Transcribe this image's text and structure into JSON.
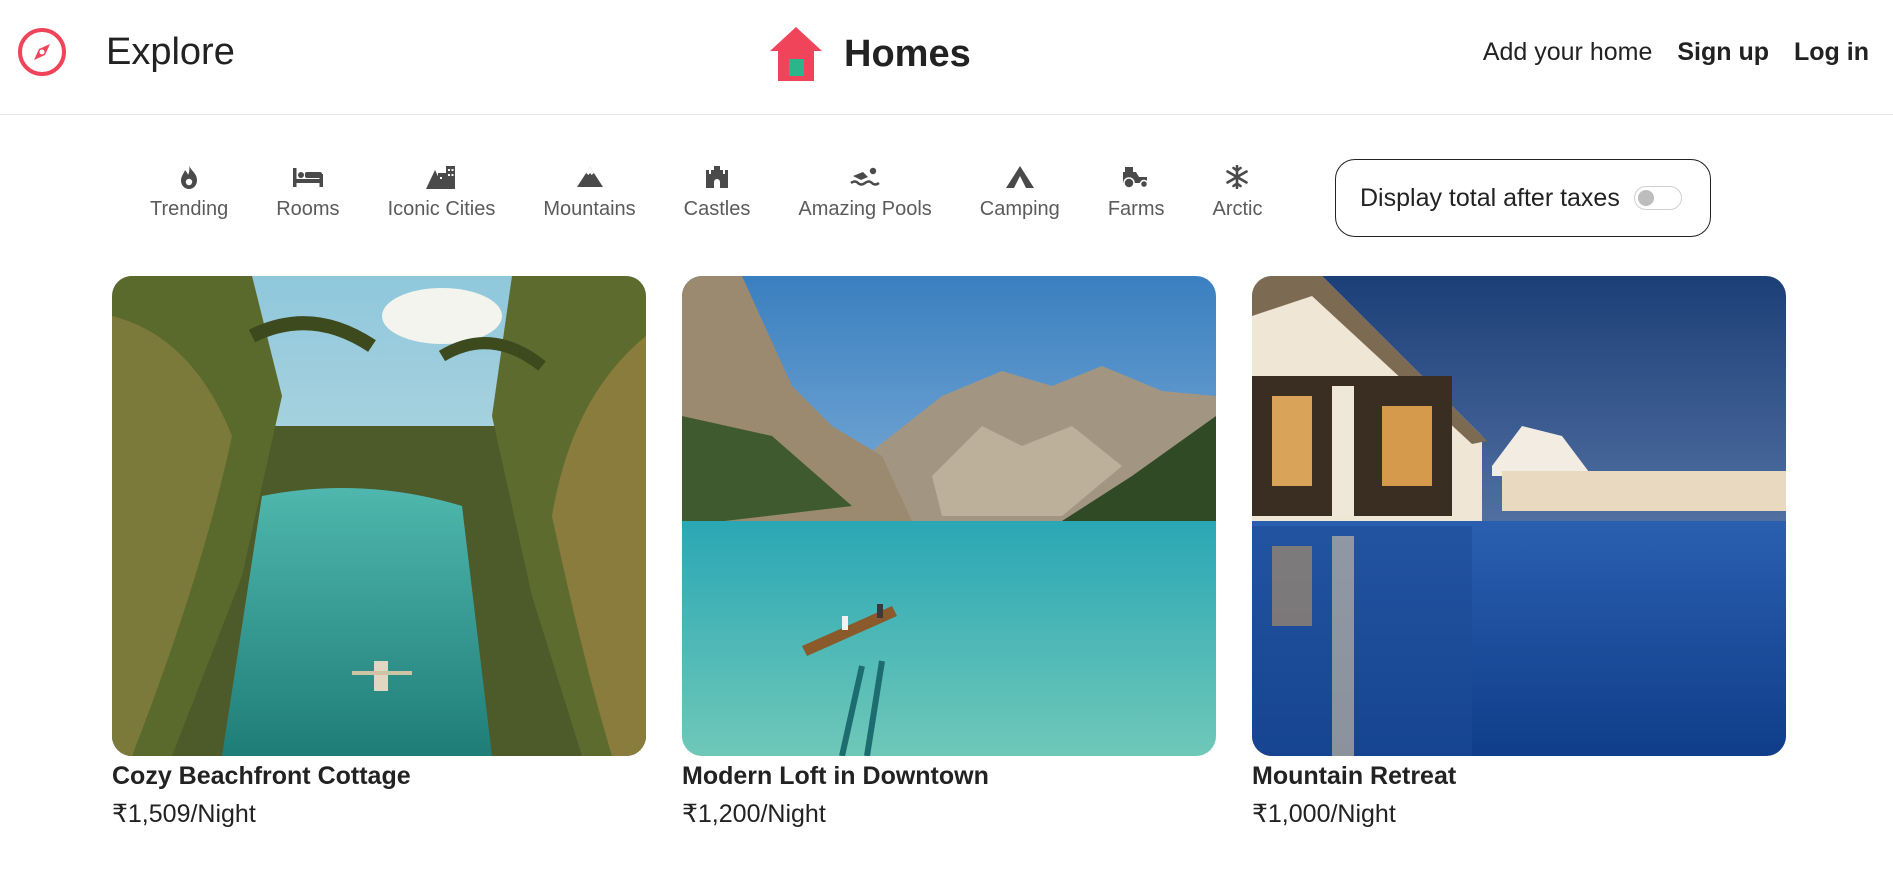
{
  "header": {
    "explore_label": "Explore",
    "brand_label": "Homes",
    "nav": {
      "add_home": "Add your home",
      "sign_up": "Sign up",
      "log_in": "Log in"
    }
  },
  "colors": {
    "accent": "#f0445a",
    "brand_door": "#29b68a",
    "text": "#222222"
  },
  "filters": [
    {
      "label": "Trending",
      "icon": "fire-icon"
    },
    {
      "label": "Rooms",
      "icon": "bed-icon"
    },
    {
      "label": "Iconic Cities",
      "icon": "city-icon"
    },
    {
      "label": "Mountains",
      "icon": "mountain-icon"
    },
    {
      "label": "Castles",
      "icon": "castle-icon"
    },
    {
      "label": "Amazing Pools",
      "icon": "swimmer-icon"
    },
    {
      "label": "Camping",
      "icon": "tent-icon"
    },
    {
      "label": "Farms",
      "icon": "tractor-icon"
    },
    {
      "label": "Arctic",
      "icon": "snowflake-icon"
    }
  ],
  "tax_toggle": {
    "label": "Display total after taxes",
    "enabled": false
  },
  "listings": [
    {
      "title": "Cozy Beachfront Cottage",
      "price": "₹1,509/Night",
      "image": "palm-lagoon-photo"
    },
    {
      "title": "Modern Loft in Downtown",
      "price": "₹1,200/Night",
      "image": "mountain-lake-photo"
    },
    {
      "title": "Mountain Retreat",
      "price": "₹1,000/Night",
      "image": "resort-pool-photo"
    }
  ]
}
